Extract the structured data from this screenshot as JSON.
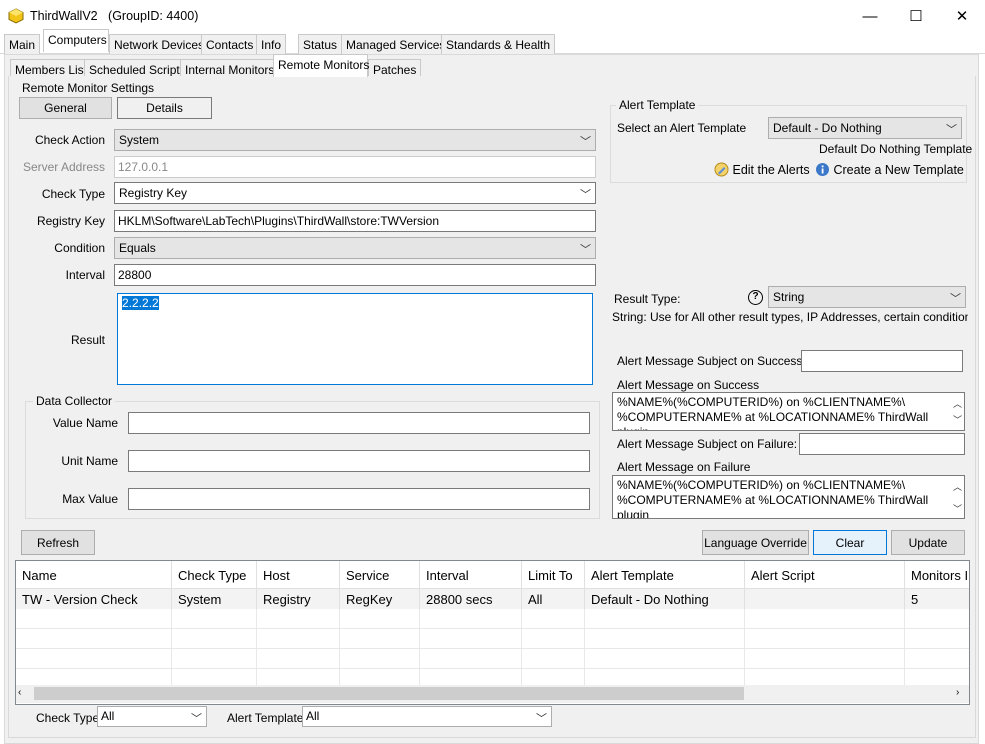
{
  "window": {
    "title": "ThirdWallV2",
    "group": "(GroupID: 4400)",
    "minimize": "—",
    "maximize": "☐",
    "close": "✕"
  },
  "main_tabs": [
    "Main",
    "Computers",
    "Network Devices",
    "Contacts",
    "Info",
    "Status",
    "Managed Services",
    "Standards & Health"
  ],
  "sub_tabs": [
    "Members List",
    "Scheduled Scripts",
    "Internal Monitors",
    "Remote Monitors",
    "Patches"
  ],
  "settings": {
    "section_title": "Remote Monitor Settings",
    "general_btn": "General",
    "details_btn": "Details",
    "check_action_label": "Check Action",
    "check_action": "System",
    "server_address_label": "Server Address",
    "server_address": "127.0.0.1",
    "check_type_label": "Check Type",
    "check_type": "Registry Key",
    "registry_key_label": "Registry Key",
    "registry_key": "HKLM\\Software\\LabTech\\Plugins\\ThirdWall\\store:TWVersion",
    "condition_label": "Condition",
    "condition": "Equals",
    "interval_label": "Interval",
    "interval": "28800",
    "result_label": "Result",
    "result": "2.2.2.2"
  },
  "data_collector": {
    "title": "Data Collector",
    "value_name_label": "Value Name",
    "value_name": "",
    "unit_name_label": "Unit Name",
    "unit_name": "",
    "max_value_label": "Max Value",
    "max_value": ""
  },
  "alert_template": {
    "title": "Alert Template",
    "select_label": "Select an Alert Template",
    "selected": "Default - Do Nothing",
    "description": "Default Do Nothing Template",
    "edit_link": "Edit the Alerts",
    "create_link": "Create a New Template"
  },
  "result_type": {
    "label": "Result Type:",
    "help": "?",
    "value": "String",
    "hint": "String: Use for All other result types, IP Addresses, certain conditions, and"
  },
  "alerts": {
    "subject_success_label": "Alert Message Subject on Success:",
    "subject_success": "",
    "msg_success_label": "Alert Message on Success",
    "msg_success": "%NAME%(%COMPUTERID%) on %CLIENTNAME%\\\n%COMPUTERNAME% at %LOCATIONNAME% ThirdWall plugin",
    "subject_failure_label": "Alert Message Subject on Failure:",
    "subject_failure": "",
    "msg_failure_label": "Alert Message on Failure",
    "msg_failure": "%NAME%(%COMPUTERID%) on %CLIENTNAME%\\\n%COMPUTERNAME% at %LOCATIONNAME% ThirdWall plugin"
  },
  "buttons": {
    "refresh": "Refresh",
    "language_override": "Language Override",
    "clear": "Clear",
    "update": "Update"
  },
  "table": {
    "headers": [
      "Name",
      "Check Type",
      "Host",
      "Service",
      "Interval",
      "Limit To",
      "Alert Template",
      "Alert Script",
      "Monitors I"
    ],
    "rows": [
      [
        "TW - Version Check",
        "System",
        "Registry",
        "RegKey",
        "28800 secs",
        "All",
        "Default - Do Nothing",
        "",
        "5"
      ]
    ]
  },
  "filters": {
    "check_type_label": "Check Type",
    "check_type": "All",
    "alert_template_label": "Alert Template",
    "alert_template": "All"
  }
}
